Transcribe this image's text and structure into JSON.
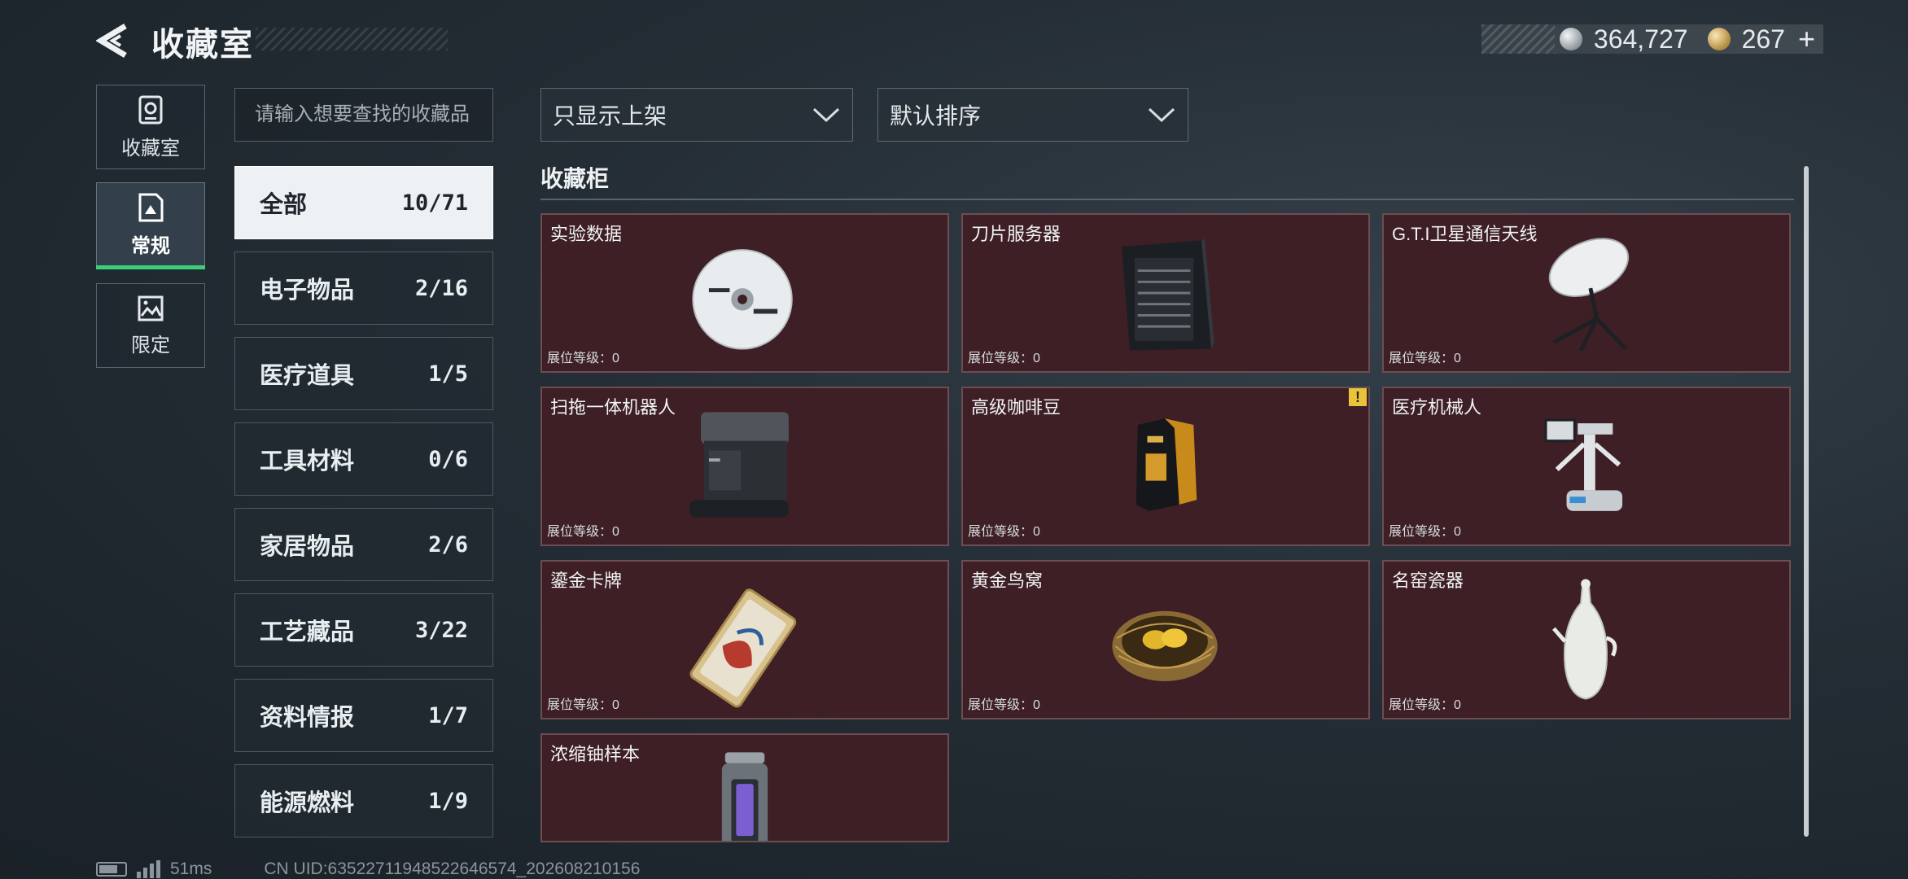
{
  "header": {
    "title": "收藏室",
    "currency": [
      {
        "icon": "silver-coin-icon",
        "value": "364,727"
      },
      {
        "icon": "gold-coin-icon",
        "value": "267"
      }
    ],
    "add_label": "+"
  },
  "nav": [
    {
      "label": "收藏室",
      "icon": "vault-icon"
    },
    {
      "label": "常规",
      "icon": "document-icon",
      "active": true
    },
    {
      "label": "限定",
      "icon": "picture-icon"
    }
  ],
  "search": {
    "placeholder": "请输入想要查找的收藏品"
  },
  "categories": [
    {
      "name": "全部",
      "count": "10/71",
      "active": true
    },
    {
      "name": "电子物品",
      "count": "2/16"
    },
    {
      "name": "医疗道具",
      "count": "1/5"
    },
    {
      "name": "工具材料",
      "count": "0/6"
    },
    {
      "name": "家居物品",
      "count": "2/6"
    },
    {
      "name": "工艺藏品",
      "count": "3/22"
    },
    {
      "name": "资料情报",
      "count": "1/7"
    },
    {
      "name": "能源燃料",
      "count": "1/9"
    }
  ],
  "filters": {
    "display": "只显示上架",
    "sort": "默认排序"
  },
  "section": {
    "title": "收藏柜"
  },
  "items": [
    {
      "name": "实验数据",
      "level": "展位等级：0"
    },
    {
      "name": "刀片服务器",
      "level": "展位等级：0"
    },
    {
      "name": "G.T.I卫星通信天线",
      "level": "展位等级：0"
    },
    {
      "name": "扫拖一体机器人",
      "level": "展位等级：0"
    },
    {
      "name": "高级咖啡豆",
      "level": "展位等级：0",
      "alert": "!"
    },
    {
      "name": "医疗机械人",
      "level": "展位等级：0"
    },
    {
      "name": "鎏金卡牌",
      "level": "展位等级：0"
    },
    {
      "name": "黄金鸟窝",
      "level": "展位等级：0"
    },
    {
      "name": "名窑瓷器",
      "level": "展位等级：0"
    },
    {
      "name": "浓缩铀样本",
      "level": ""
    }
  ],
  "footer": {
    "ping": "51ms",
    "uid": "CN UID:63522711948522646574_202608210156"
  },
  "colors": {
    "card_bg": "#3d1f25",
    "card_border": "#6b4d52",
    "nav_active_underline": "#3ad07a",
    "alert_badge": "#e9c43a"
  }
}
